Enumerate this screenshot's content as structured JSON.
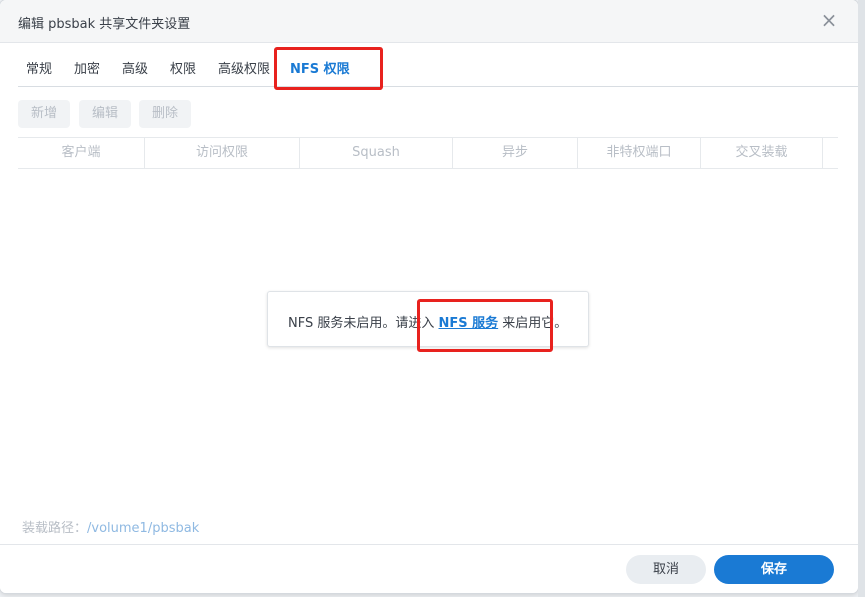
{
  "dialog": {
    "title": "编辑 pbsbak 共享文件夹设置",
    "close_glyph": "×"
  },
  "tabs": [
    "常规",
    "加密",
    "高级",
    "权限",
    "高级权限",
    "NFS 权限"
  ],
  "active_tab": "NFS 权限",
  "toolbar": {
    "add_label": "新增",
    "edit_label": "编辑",
    "delete_label": "删除"
  },
  "table": {
    "columns": [
      "客户端",
      "访问权限",
      "Squash",
      "异步",
      "非特权端口",
      "交叉装载"
    ]
  },
  "notice": {
    "text_before": "NFS 服务未启用。请进入 ",
    "link_text": "NFS 服务",
    "text_after": " 来启用它。"
  },
  "mount_path": {
    "label": "装载路径：",
    "value": "/volume1/pbsbak"
  },
  "footer": {
    "cancel_label": "取消",
    "save_label": "保存"
  },
  "colors": {
    "accent": "#1a7ad4",
    "highlight_box": "#e8221e"
  }
}
